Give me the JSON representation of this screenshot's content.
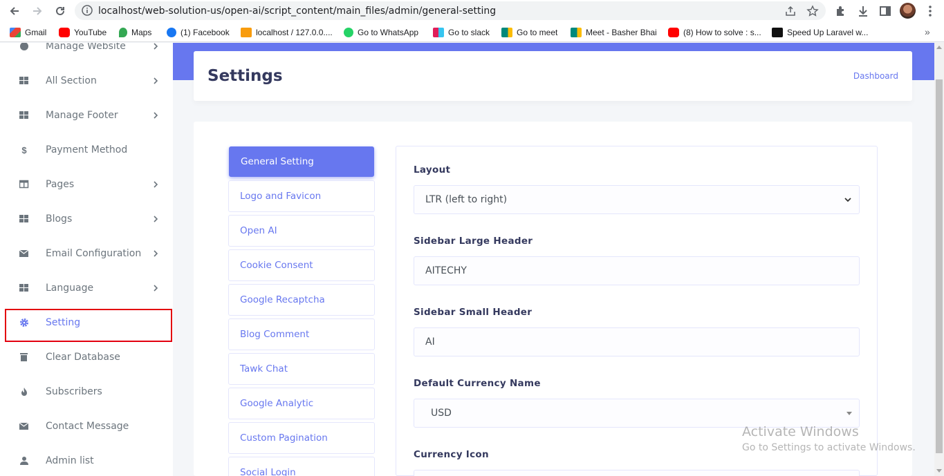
{
  "browser": {
    "url": "localhost/web-solution-us/open-ai/script_content/main_files/admin/general-setting",
    "bookmarks": [
      {
        "label": "Gmail",
        "color": "#ea4335"
      },
      {
        "label": "YouTube",
        "color": "#ff0000"
      },
      {
        "label": "Maps",
        "color": "#34a853"
      },
      {
        "label": "(1) Facebook",
        "color": "#1877f2"
      },
      {
        "label": "localhost / 127.0.0....",
        "color": "#f89c0e"
      },
      {
        "label": "Go to WhatsApp",
        "color": "#25d366"
      },
      {
        "label": "Go to slack",
        "color": "#e01e5a"
      },
      {
        "label": "Go to meet",
        "color": "#00897b"
      },
      {
        "label": "Meet - Basher Bhai",
        "color": "#00897b"
      },
      {
        "label": "(8) How to solve : s...",
        "color": "#ff0000"
      },
      {
        "label": "Speed Up Laravel w...",
        "color": "#111111"
      }
    ],
    "bookmarks_more": "»"
  },
  "sidebar": {
    "items": [
      {
        "label": "Manage Website",
        "icon": "globe-icon",
        "has_children": true
      },
      {
        "label": "All Section",
        "icon": "grid-icon",
        "has_children": true
      },
      {
        "label": "Manage Footer",
        "icon": "grid-icon",
        "has_children": true
      },
      {
        "label": "Payment Method",
        "icon": "dollar-icon",
        "has_children": false
      },
      {
        "label": "Pages",
        "icon": "columns-icon",
        "has_children": true
      },
      {
        "label": "Blogs",
        "icon": "grid-icon",
        "has_children": true
      },
      {
        "label": "Email Configuration",
        "icon": "envelope-icon",
        "has_children": true
      },
      {
        "label": "Language",
        "icon": "grid-icon",
        "has_children": true
      },
      {
        "label": "Setting",
        "icon": "gear-icon",
        "has_children": false,
        "active": true
      },
      {
        "label": "Clear Database",
        "icon": "trash-icon",
        "has_children": false
      },
      {
        "label": "Subscribers",
        "icon": "fire-icon",
        "has_children": false
      },
      {
        "label": "Contact Message",
        "icon": "envelope-icon",
        "has_children": false
      },
      {
        "label": "Admin list",
        "icon": "user-icon",
        "has_children": false
      }
    ]
  },
  "header": {
    "title": "Settings",
    "breadcrumb": "Dashboard"
  },
  "tabs": [
    {
      "label": "General Setting",
      "active": true
    },
    {
      "label": "Logo and Favicon"
    },
    {
      "label": "Open AI"
    },
    {
      "label": "Cookie Consent"
    },
    {
      "label": "Google Recaptcha"
    },
    {
      "label": "Blog Comment"
    },
    {
      "label": "Tawk Chat"
    },
    {
      "label": "Google Analytic"
    },
    {
      "label": "Custom Pagination"
    },
    {
      "label": "Social Login"
    }
  ],
  "form": {
    "layout_label": "Layout",
    "layout_value": "LTR (left to right)",
    "sidebar_large_label": "Sidebar Large Header",
    "sidebar_large_value": "AITECHY",
    "sidebar_small_label": "Sidebar Small Header",
    "sidebar_small_value": "AI",
    "currency_name_label": "Default Currency Name",
    "currency_name_value": "USD",
    "currency_icon_label": "Currency Icon"
  },
  "watermark": {
    "line1": "Activate Windows",
    "line2": "Go to Settings to activate Windows."
  },
  "colors": {
    "primary": "#6777ef",
    "highlight": "#e3000f"
  }
}
